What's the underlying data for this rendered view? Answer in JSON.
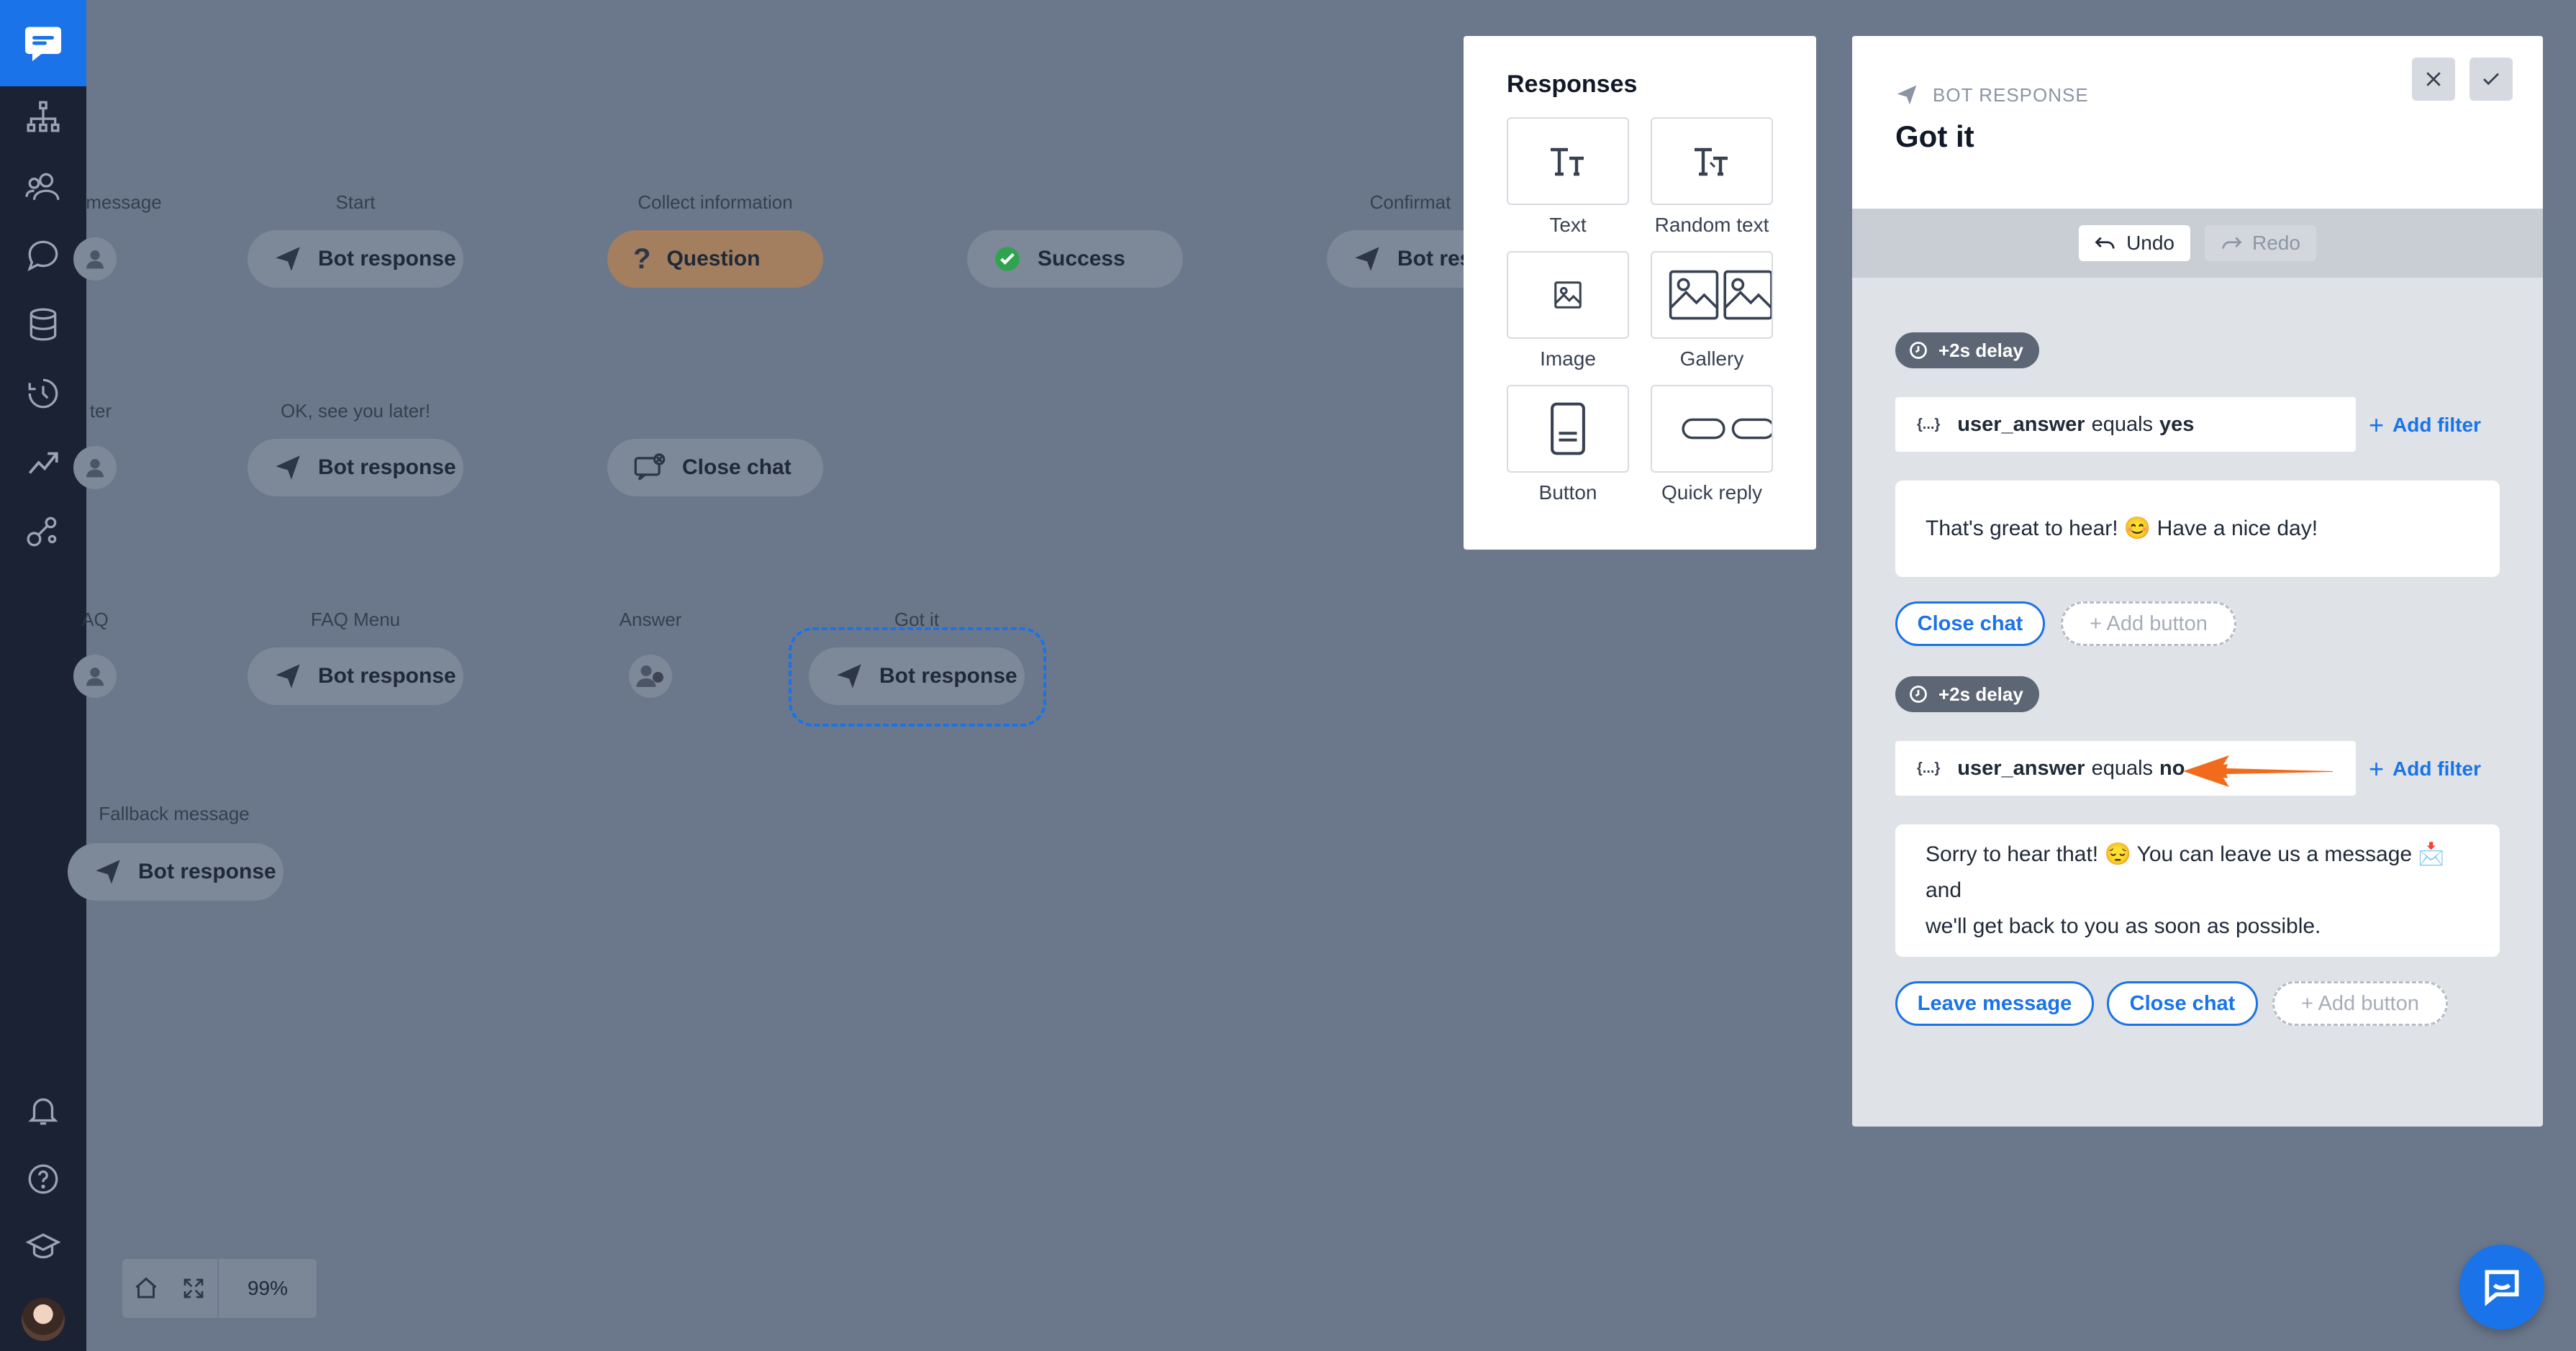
{
  "sidebar": {
    "icons": [
      "chat-logo-icon",
      "bot-structure-icon",
      "audience-icon",
      "chat-bubble-icon",
      "database-icon",
      "history-icon",
      "reports-icon",
      "integrations-icon",
      "bell-icon",
      "help-icon",
      "academy-icon",
      "user-avatar"
    ]
  },
  "canvas": {
    "columns": [
      {
        "label": "message"
      },
      {
        "label": "Start"
      },
      {
        "label": "Collect information"
      },
      {
        "label": "Confirmat"
      }
    ],
    "row2_labels": [
      "ter",
      "OK, see you later!"
    ],
    "row3_labels": [
      "AQ",
      "FAQ Menu",
      "Answer",
      "Got it"
    ],
    "row4_labels": [
      "Fallback message"
    ],
    "nodes": {
      "bot_response": "Bot response",
      "question": "Question",
      "success": "Success",
      "close_chat": "Close chat",
      "bot_resp_truncated": "Bot resp"
    }
  },
  "zoom": {
    "value": "99%"
  },
  "responses": {
    "title": "Responses",
    "tiles": [
      {
        "label": "Text",
        "icon": "text-icon"
      },
      {
        "label": "Random text",
        "icon": "random-text-icon"
      },
      {
        "label": "Image",
        "icon": "image-icon"
      },
      {
        "label": "Gallery",
        "icon": "gallery-icon"
      },
      {
        "label": "Button",
        "icon": "button-icon"
      },
      {
        "label": "Quick reply",
        "icon": "quick-reply-icon"
      }
    ]
  },
  "panel": {
    "eyebrow": "BOT RESPONSE",
    "title": "Got it",
    "undo": "Undo",
    "redo": "Redo",
    "blocks": [
      {
        "delay": "+2s delay",
        "filter": {
          "variable": "user_answer",
          "op": "equals",
          "value": "yes"
        },
        "add_filter": "Add filter",
        "message": "That's great to hear! 😊 Have a nice day!",
        "buttons": [
          "Close chat"
        ],
        "add_button": "+ Add button"
      },
      {
        "delay": "+2s delay",
        "filter": {
          "variable": "user_answer",
          "op": "equals",
          "value": "no"
        },
        "add_filter": "Add filter",
        "message_line1": "Sorry to hear that! 😔 You can leave us a message 📩 and",
        "message_line2": "we'll get back to you as soon as possible.",
        "buttons": [
          "Leave message",
          "Close chat"
        ],
        "add_button": "+ Add button"
      }
    ]
  },
  "colors": {
    "accent": "#1a73e8",
    "arrow": "#f26a1b",
    "success": "#2ea44f"
  }
}
